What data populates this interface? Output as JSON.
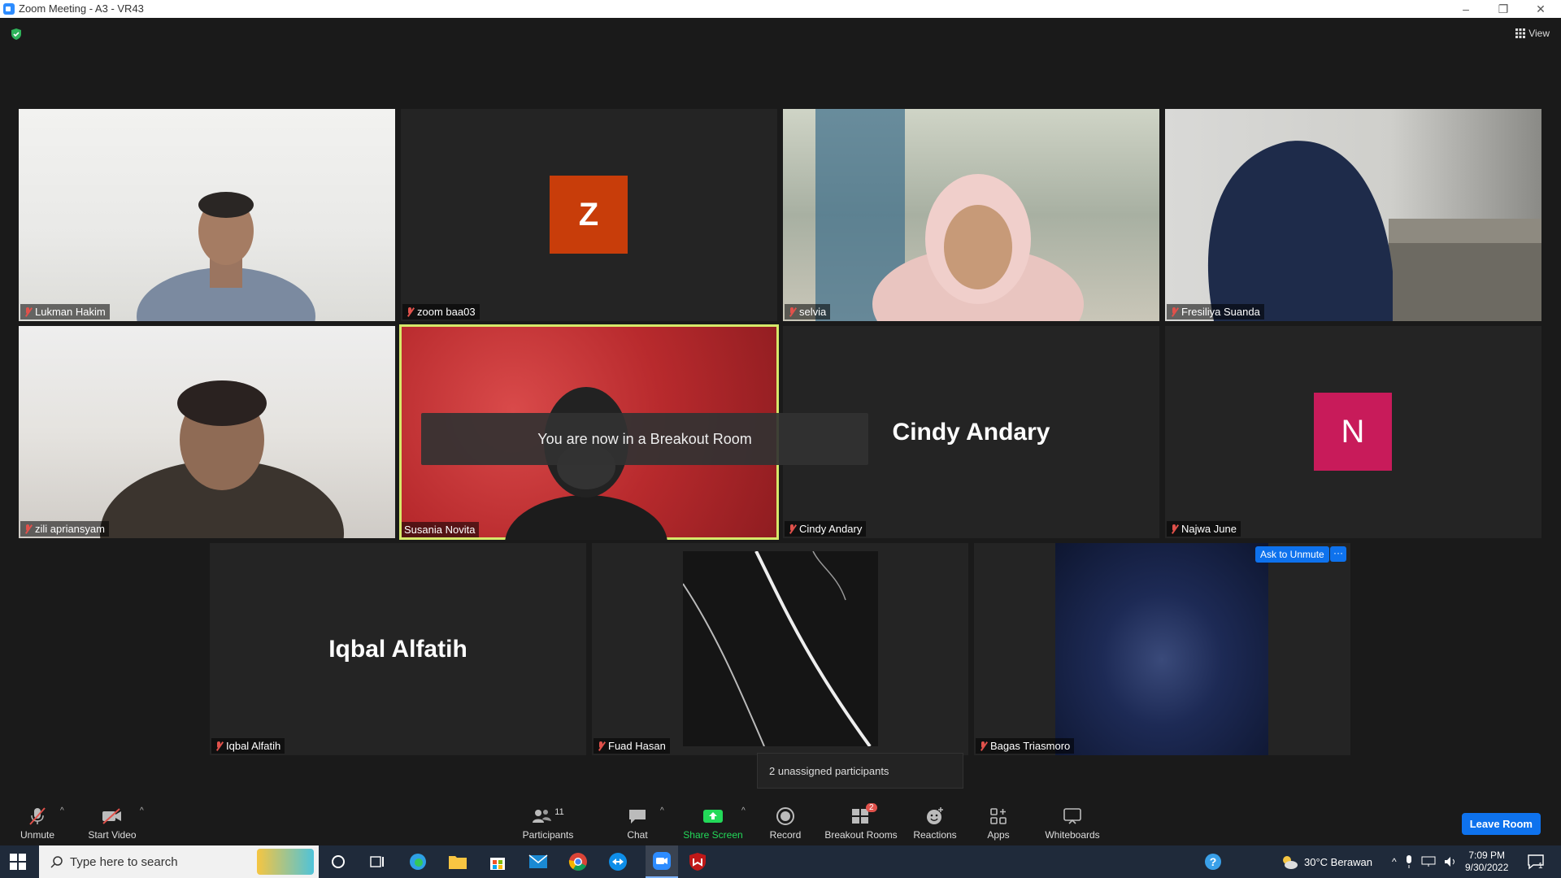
{
  "window": {
    "title": "Zoom Meeting - A3 - VR43",
    "minimize": "–",
    "restore": "❐",
    "close": "✕"
  },
  "top": {
    "view_label": "View"
  },
  "tiles": [
    {
      "name": "Lukman Hakim"
    },
    {
      "name": "zoom baa03",
      "avatar_letter": "Z",
      "avatar_color": "#c83d0a"
    },
    {
      "name": "selvia"
    },
    {
      "name": "Fresiliya Suanda"
    },
    {
      "name": "zili apriansyam"
    },
    {
      "name": "Susania Novita"
    },
    {
      "name": "Cindy Andary",
      "display_name": "Cindy Andary"
    },
    {
      "name": "Najwa June",
      "avatar_letter": "N",
      "avatar_color": "#c81b5a"
    },
    {
      "name": "Iqbal Alfatih",
      "display_name": "Iqbal Alfatih"
    },
    {
      "name": "Fuad Hasan"
    },
    {
      "name": "Bagas Triasmoro"
    }
  ],
  "toast": "You are now in a Breakout Room",
  "ask_unmute": "Ask to Unmute",
  "more": "···",
  "tooltip": "2 unassigned participants",
  "toolbar": {
    "unmute": "Unmute",
    "start_video": "Start Video",
    "participants": "Participants",
    "participants_count": "11",
    "chat": "Chat",
    "share_screen": "Share Screen",
    "record": "Record",
    "breakout_rooms": "Breakout Rooms",
    "breakout_badge": "2",
    "reactions": "Reactions",
    "apps": "Apps",
    "whiteboards": "Whiteboards",
    "leave_room": "Leave Room"
  },
  "taskbar": {
    "search_placeholder": "Type here to search",
    "weather": "30°C  Berawan",
    "time": "7:09 PM",
    "date": "9/30/2022",
    "notif_count": "1"
  },
  "colors": {
    "accent": "#0e72ed",
    "speaking_border": "#d6e86a",
    "share_green": "#23d959",
    "muted_red": "#e0514b"
  }
}
